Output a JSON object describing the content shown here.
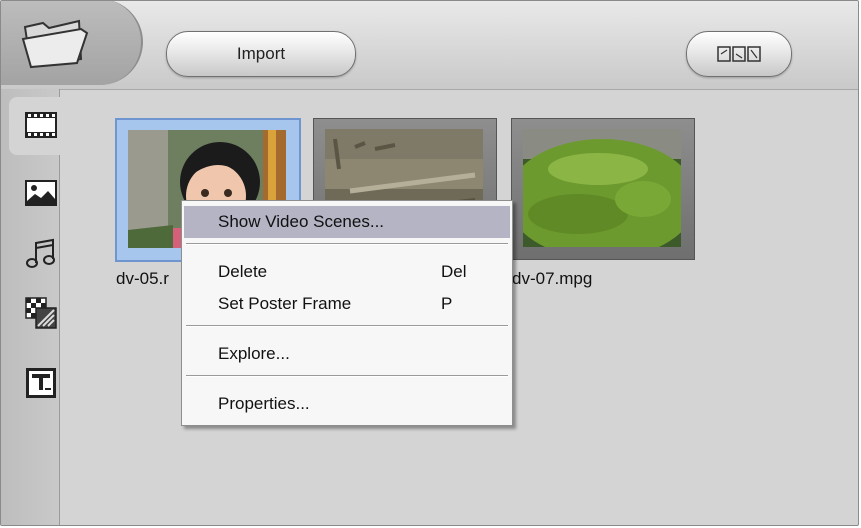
{
  "toolbar": {
    "import_label": "Import",
    "folder_icon": "folder-icon",
    "capture_icon": "capture-icon"
  },
  "sidebar": {
    "items": [
      {
        "name": "video",
        "icon": "film-strip-icon",
        "active": true
      },
      {
        "name": "image",
        "icon": "landscape-image-icon"
      },
      {
        "name": "audio",
        "icon": "music-note-icon"
      },
      {
        "name": "transitions",
        "icon": "transition-checker-icon"
      },
      {
        "name": "titles",
        "icon": "title-text-icon"
      }
    ]
  },
  "media": {
    "items": [
      {
        "label": "dv-05.r",
        "selected": true
      },
      {
        "label": ""
      },
      {
        "label": "dv-07.mpg"
      }
    ]
  },
  "context_menu": {
    "items": [
      {
        "label": "Show Video Scenes...",
        "shortcut": "",
        "highlighted": true
      },
      {
        "label": "Delete",
        "shortcut": "Del"
      },
      {
        "label": "Set Poster Frame",
        "shortcut": "P"
      },
      {
        "label": "Explore...",
        "shortcut": ""
      },
      {
        "label": "Properties...",
        "shortcut": ""
      }
    ]
  },
  "colors": {
    "panel": "#d4d4d4",
    "selection": "#a7c6ee",
    "menu_highlight": "#b4b4c4"
  }
}
